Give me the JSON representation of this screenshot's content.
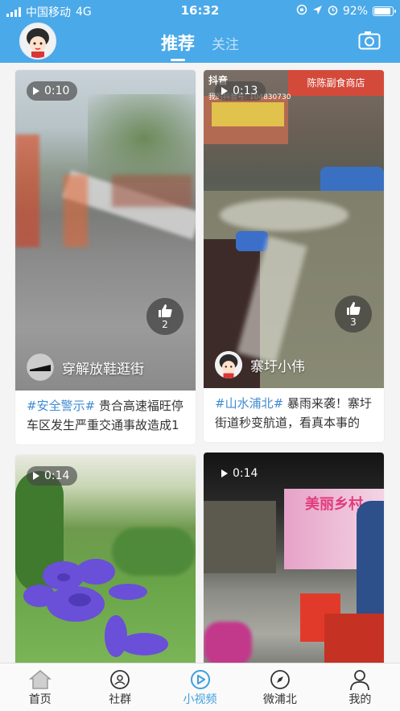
{
  "status": {
    "carrier": "中国移动",
    "network": "4G",
    "time": "16:32",
    "battery": "92%",
    "battery_level": 0.92
  },
  "header": {
    "tabs": [
      {
        "label": "推荐",
        "active": true
      },
      {
        "label": "关注",
        "active": false
      }
    ]
  },
  "cards": [
    {
      "duration": "0:10",
      "likes": "2",
      "author": "穿解放鞋逛街",
      "caption_tag": "#安全警示#",
      "caption_text": " 贵合高速福旺停车区发生严重交通事故造成1"
    },
    {
      "duration": "0:13",
      "likes": "3",
      "author": "寨圩小伟",
      "caption_tag": "#山水浦北#",
      "caption_text": " 暴雨来袭！寨圩街道秒变航道，看真本事的",
      "overlay_watermark": "抖音",
      "overlay_id": "我的抖音号: 104830730",
      "overlay_shop": "陈陈副食商店"
    },
    {
      "duration": "0:14"
    },
    {
      "duration": "0:14",
      "overlay_banner": "美丽乡村"
    }
  ],
  "nav": [
    {
      "label": "首页",
      "icon": "home-icon",
      "active": false
    },
    {
      "label": "社群",
      "icon": "community-icon",
      "active": false
    },
    {
      "label": "小视频",
      "icon": "play-icon",
      "active": true
    },
    {
      "label": "微浦北",
      "icon": "compass-icon",
      "active": false
    },
    {
      "label": "我的",
      "icon": "person-icon",
      "active": false
    }
  ],
  "colors": {
    "header_bg": "#4aa9e9",
    "accent": "#3f9fde",
    "tag": "#3f8bd1"
  }
}
